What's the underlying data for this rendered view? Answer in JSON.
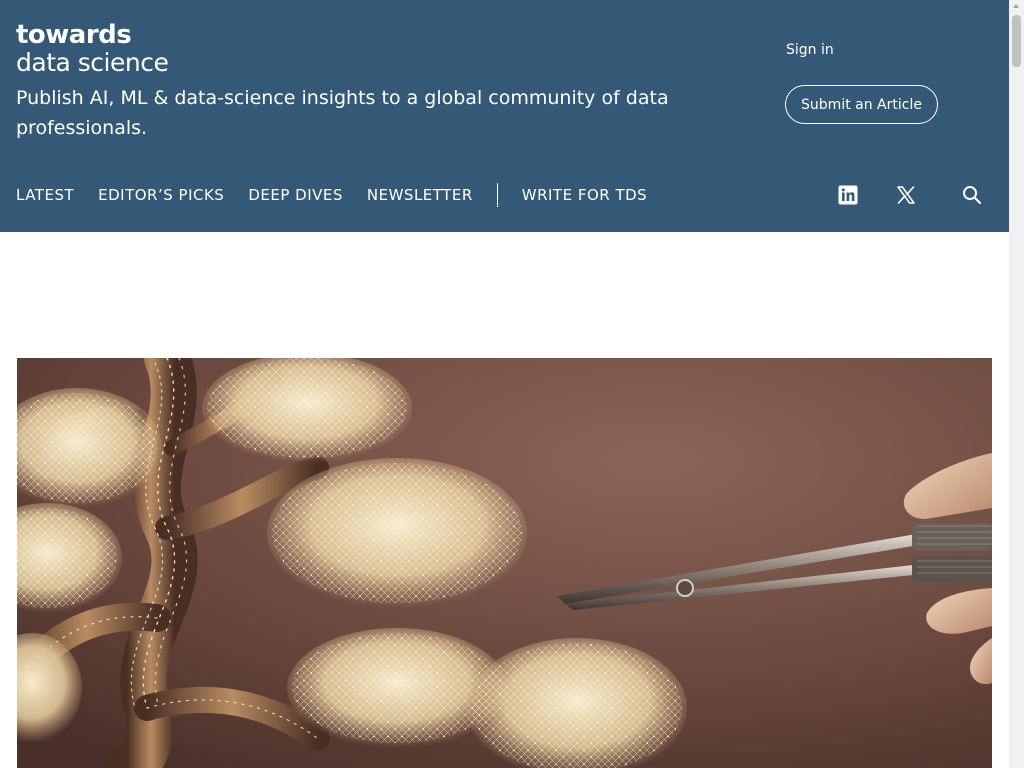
{
  "header": {
    "logo_line1": "towards",
    "logo_line2": "data science",
    "tagline": "Publish AI, ML & data-science insights to a global community of data professionals.",
    "sign_in": "Sign in",
    "submit_button": "Submit an Article",
    "background_color": "#355876"
  },
  "nav": {
    "items": [
      {
        "label": "LATEST"
      },
      {
        "label": "EDITOR’S PICKS"
      },
      {
        "label": "DEEP DIVES"
      },
      {
        "label": "NEWSLETTER"
      }
    ],
    "write_label": "WRITE FOR TDS",
    "icons": [
      "linkedin-icon",
      "x-twitter-icon",
      "search-icon"
    ]
  },
  "hero": {
    "icon": "hero-image",
    "colors": {
      "background": "#6d4a40",
      "network": "#f3dcae"
    }
  }
}
